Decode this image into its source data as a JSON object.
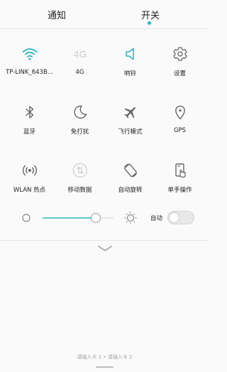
{
  "tabs": [
    {
      "label": "通知"
    },
    {
      "label": "开关"
    }
  ],
  "accent_color": "#29b6c6",
  "toggles": [
    {
      "label": "TP-LINK_643B...",
      "icon": "wifi-icon",
      "active": true
    },
    {
      "label": "4G",
      "icon": "4g-icon",
      "active": false
    },
    {
      "label": "响铃",
      "icon": "speaker-icon",
      "active": true
    },
    {
      "label": "设置",
      "icon": "gear-icon",
      "active": false
    },
    {
      "label": "蓝牙",
      "icon": "bluetooth-icon",
      "active": false
    },
    {
      "label": "免打扰",
      "icon": "moon-icon",
      "active": false
    },
    {
      "label": "飞行模式",
      "icon": "airplane-icon",
      "active": false
    },
    {
      "label": "GPS",
      "icon": "location-pin-icon",
      "active": false
    },
    {
      "label": "WLAN 热点",
      "icon": "hotspot-icon",
      "active": false
    },
    {
      "label": "移动数据",
      "icon": "mobile-data-icon",
      "active": false
    },
    {
      "label": "自动旋转",
      "icon": "rotate-icon",
      "active": false
    },
    {
      "label": "单手操作",
      "icon": "one-hand-icon",
      "active": false
    }
  ],
  "brightness": {
    "level": 0.75,
    "auto_label": "自动",
    "auto_enabled": false
  },
  "sim_status": "请插入卡 1 • 请插入卡 2"
}
